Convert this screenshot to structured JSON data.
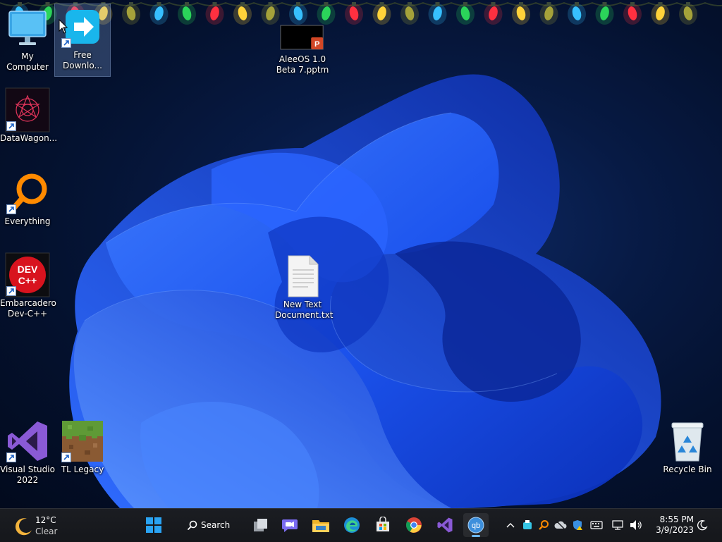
{
  "desktop": {
    "icons": [
      {
        "label": "My Computer"
      },
      {
        "label": "Free\nDownlo..."
      },
      {
        "label": "AleeOS 1.0\nBeta 7.pptm"
      },
      {
        "label": "DataWagon..."
      },
      {
        "label": "Everything"
      },
      {
        "label": "Embarcadero\nDev-C++"
      },
      {
        "label": "New Text\nDocument.txt"
      },
      {
        "label": "Visual Studio\n2022"
      },
      {
        "label": "TL Legacy"
      },
      {
        "label": "Recycle Bin"
      }
    ],
    "dev_badge": {
      "top": "DEV",
      "bottom": "C++"
    }
  },
  "taskbar": {
    "weather": {
      "temp": "12°C",
      "condition": "Clear"
    },
    "search_label": "Search",
    "pinned": [
      {
        "name": "start"
      },
      {
        "name": "task-view"
      },
      {
        "name": "chat"
      },
      {
        "name": "file-explorer"
      },
      {
        "name": "edge"
      },
      {
        "name": "store"
      },
      {
        "name": "chrome"
      },
      {
        "name": "visual-studio"
      },
      {
        "name": "qbittorrent",
        "active": true
      }
    ],
    "clock": {
      "time": "8:55 PM",
      "date": "3/9/2023"
    }
  },
  "colors": {
    "accent": "#6cb8f6",
    "taskbar_bg": "#1b1d22",
    "wallpaper_blue": "#1a5cff"
  }
}
